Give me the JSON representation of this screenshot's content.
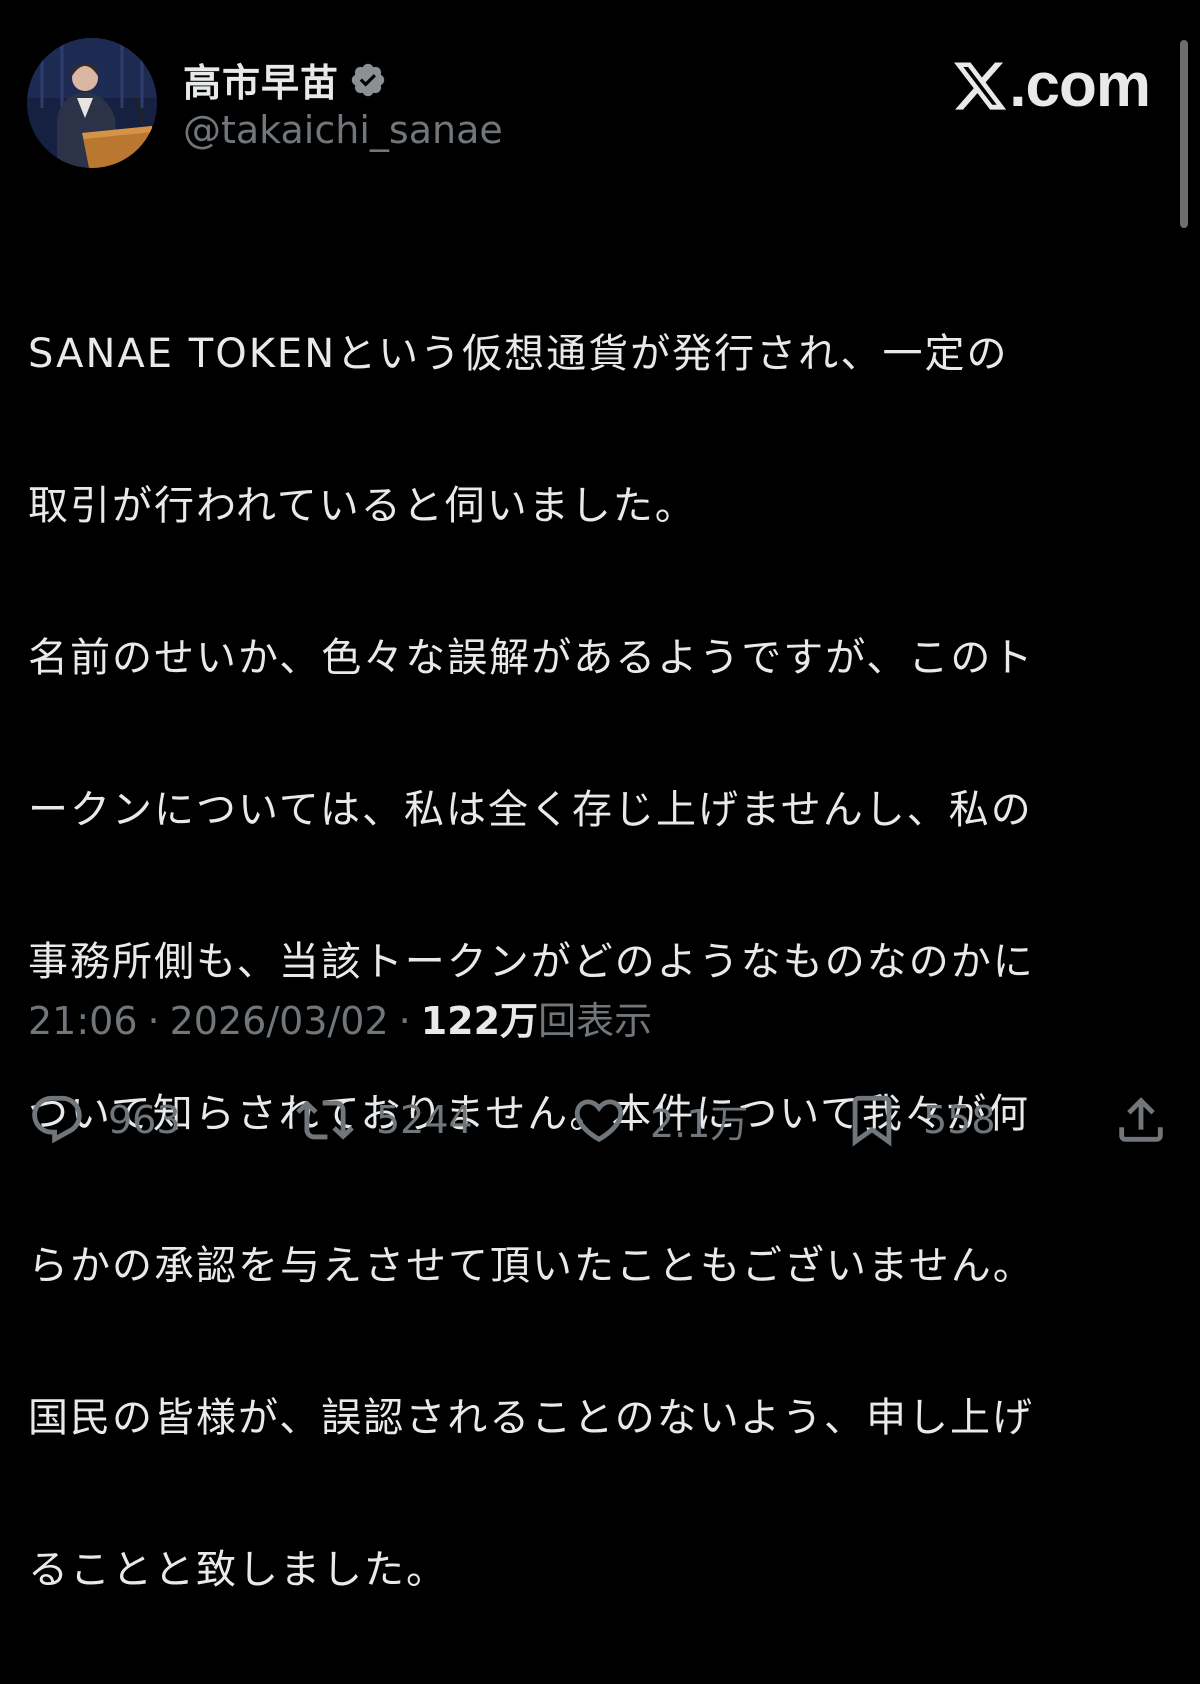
{
  "user": {
    "display_name": "高市早苗",
    "handle": "@takaichi_sanae",
    "verified": true
  },
  "brand": {
    "suffix": ".com"
  },
  "tweet": {
    "lines": [
      "SANAE TOKENという仮想通貨が発行され、一定の",
      "取引が行われていると伺いました。",
      "名前のせいか、色々な誤解があるようですが、このト",
      "ークンについては、私は全く存じ上げませんし、私の",
      "事務所側も、当該トークンがどのようなものなのかに",
      "ついて知らされておりません。本件について我々が何",
      "らかの承認を与えさせて頂いたこともございません。",
      "国民の皆様が、誤認されることのないよう、申し上げ",
      "ることと致しました。"
    ]
  },
  "meta": {
    "time": "21:06",
    "date": "2026/03/02",
    "separator": "·",
    "views_count": "122万",
    "views_label": "回表示"
  },
  "actions": {
    "replies": "963",
    "reposts": "5244",
    "likes": "2.1万",
    "bookmarks": "558"
  },
  "icons": {
    "verified": "verified-badge-icon",
    "reply": "speech-bubble-icon",
    "repost": "repost-arrows-icon",
    "like": "heart-icon",
    "bookmark": "bookmark-icon",
    "share": "share-upload-icon"
  },
  "colors": {
    "background": "#000000",
    "text": "#e7e9ea",
    "secondary": "#71767b"
  }
}
